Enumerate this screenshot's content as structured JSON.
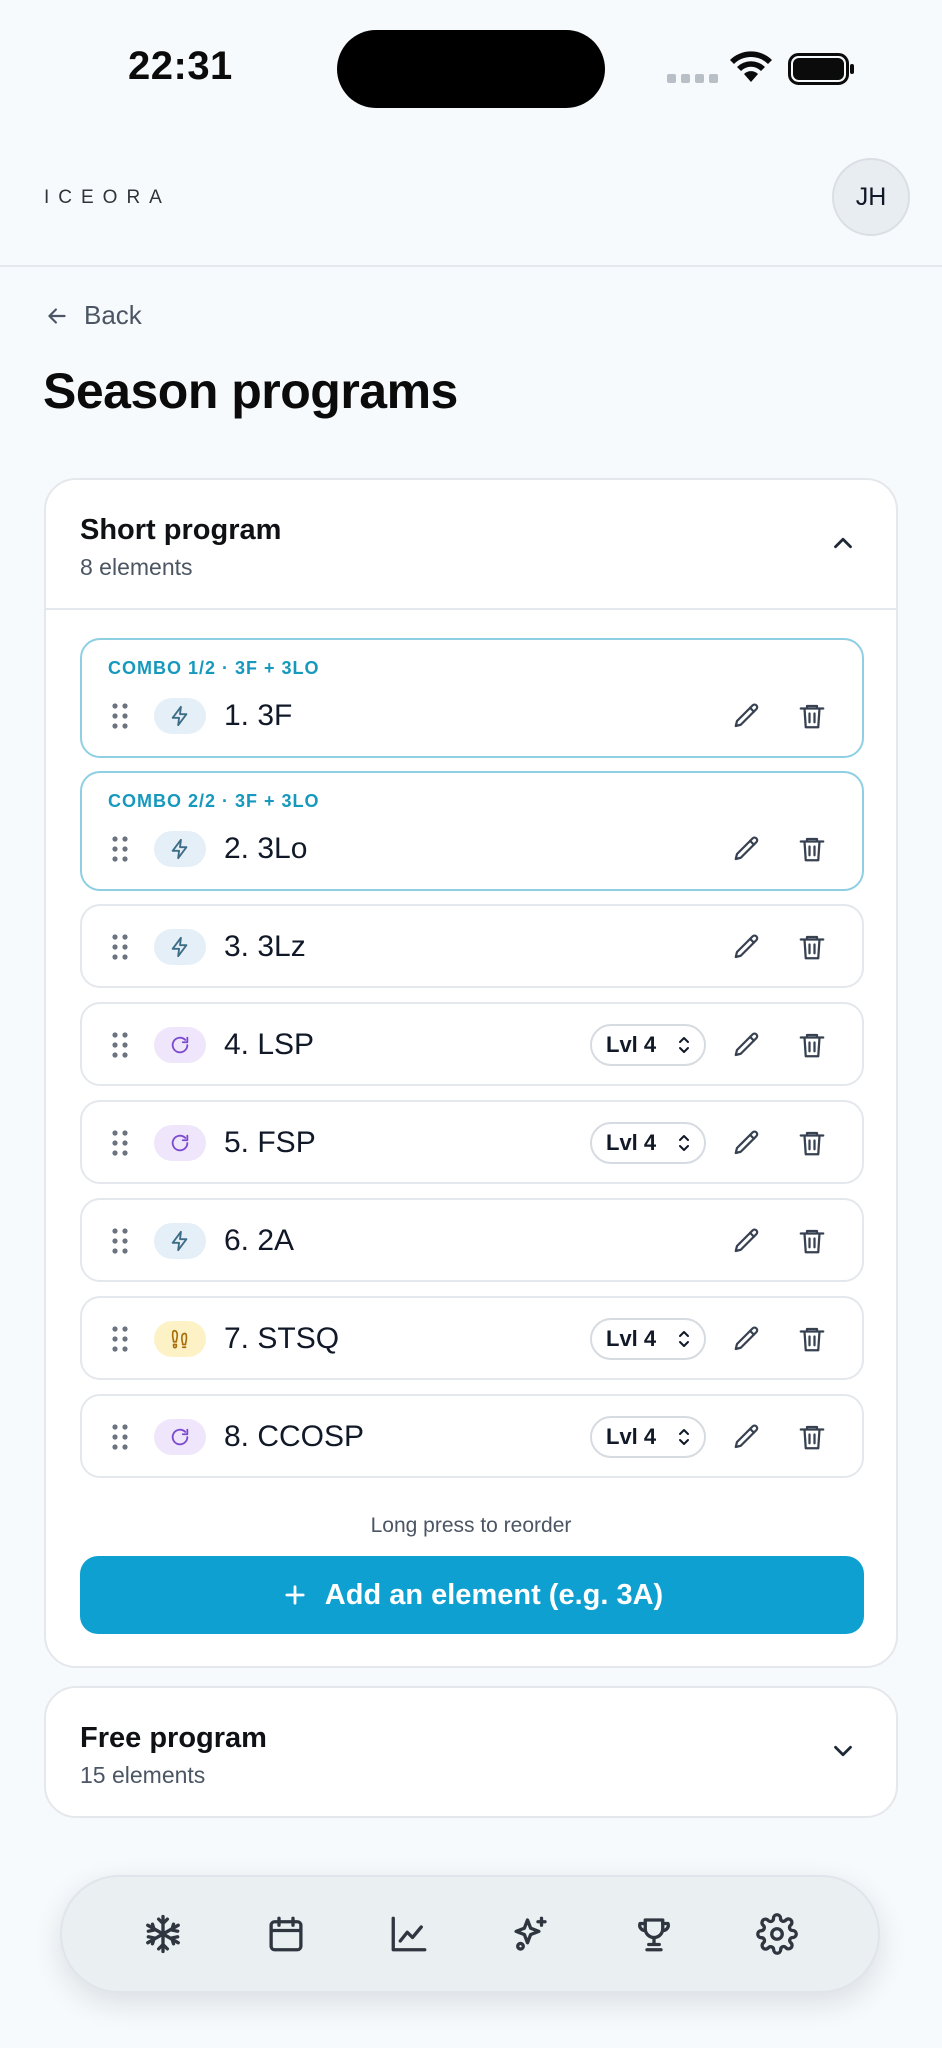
{
  "status_bar": {
    "time": "22:31"
  },
  "header": {
    "logo": "ICEORA",
    "avatar_initials": "JH"
  },
  "nav": {
    "back_label": "Back"
  },
  "page": {
    "title": "Season programs"
  },
  "short_program": {
    "title": "Short program",
    "count_label": "8 elements",
    "expanded": true,
    "elements": [
      {
        "combo_label": "COMBO 1/2 · 3F + 3LO",
        "type_icon": "bolt-icon",
        "type": "jump",
        "name": "1. 3F"
      },
      {
        "combo_label": "COMBO 2/2 · 3F + 3LO",
        "type_icon": "bolt-icon",
        "type": "jump",
        "name": "2. 3Lo"
      },
      {
        "type_icon": "bolt-icon",
        "type": "jump",
        "name": "3. 3Lz"
      },
      {
        "type_icon": "rotate-icon",
        "type": "spin",
        "name": "4. LSP",
        "level": "Lvl 4"
      },
      {
        "type_icon": "rotate-icon",
        "type": "spin",
        "name": "5. FSP",
        "level": "Lvl 4"
      },
      {
        "type_icon": "bolt-icon",
        "type": "jump",
        "name": "6. 2A"
      },
      {
        "type_icon": "footprints-icon",
        "type": "step",
        "name": "7. STSQ",
        "level": "Lvl 4"
      },
      {
        "type_icon": "rotate-icon",
        "type": "spin",
        "name": "8. CCOSP",
        "level": "Lvl 4"
      }
    ],
    "reorder_hint": "Long press to reorder",
    "add_button_label": "Add an element (e.g. 3A)"
  },
  "free_program": {
    "title": "Free program",
    "count_label": "15 elements",
    "expanded": false
  },
  "bottom_nav": {
    "items": [
      "snowflake-icon",
      "calendar-icon",
      "chart-line-icon",
      "sparkles-icon",
      "trophy-icon",
      "gear-icon"
    ]
  },
  "colors": {
    "accent": "#0ea0d0",
    "combo_border": "#8fcfe4",
    "jump_chip": "#e4eff7",
    "spin_chip": "#efe6fb",
    "step_chip": "#fdf1c6"
  }
}
